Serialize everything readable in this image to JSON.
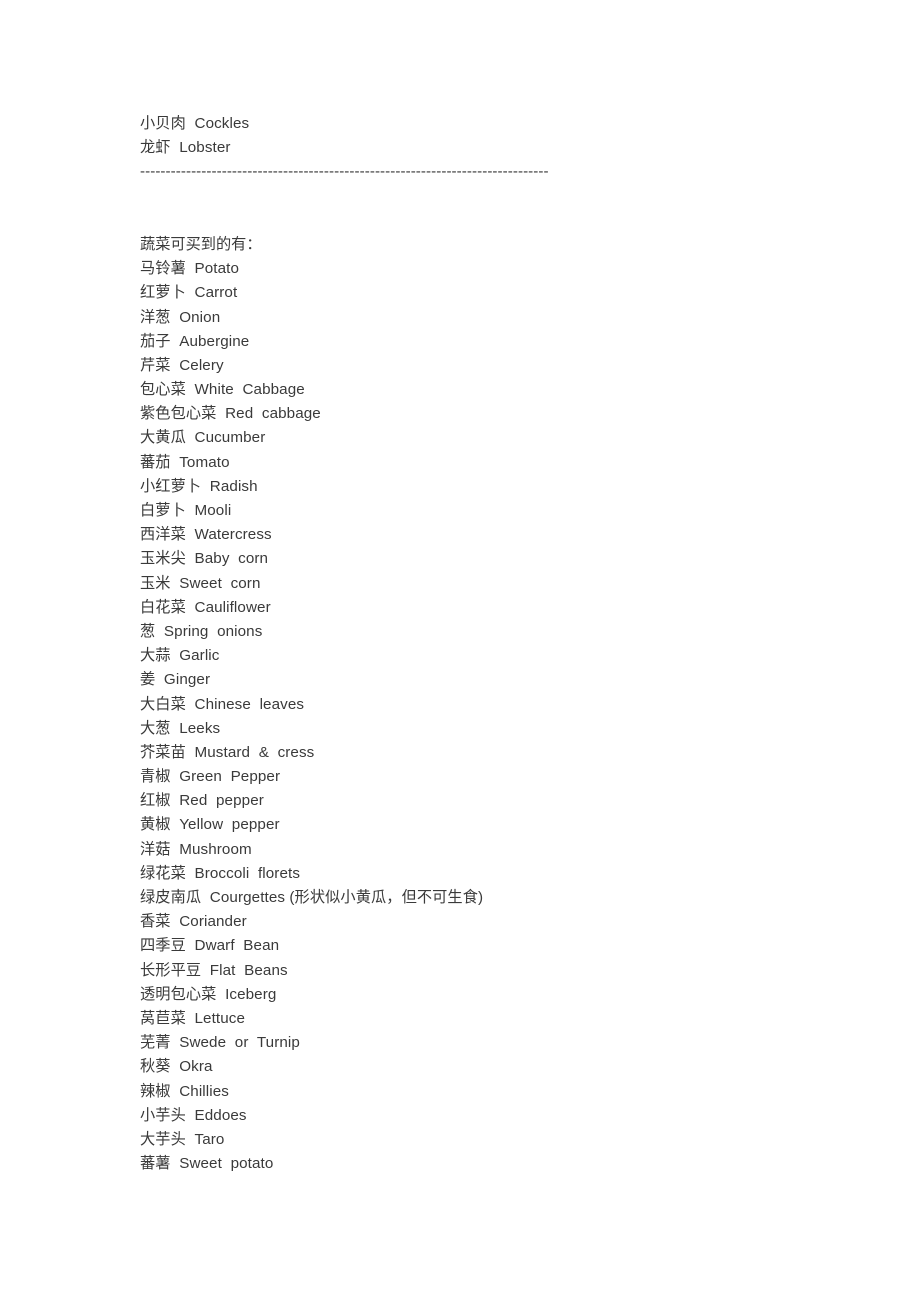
{
  "document": {
    "seafood_tail": [
      {
        "zh": "小贝肉",
        "en": "Cockles"
      },
      {
        "zh": "龙虾",
        "en": "Lobster"
      }
    ],
    "separator": "--------------------------------------------------------------------------------",
    "vegetables_heading": "蔬菜可买到的有：",
    "vegetables": [
      {
        "zh": "马铃薯",
        "en": "Potato"
      },
      {
        "zh": "红萝卜",
        "en": "Carrot"
      },
      {
        "zh": "洋葱",
        "en": "Onion"
      },
      {
        "zh": "茄子",
        "en": "Aubergine"
      },
      {
        "zh": "芹菜",
        "en": "Celery"
      },
      {
        "zh": "包心菜",
        "en": "White  Cabbage"
      },
      {
        "zh": "紫色包心菜",
        "en": "Red  cabbage"
      },
      {
        "zh": "大黄瓜",
        "en": "Cucumber"
      },
      {
        "zh": "蕃茄",
        "en": "Tomato"
      },
      {
        "zh": "小红萝卜",
        "en": "Radish"
      },
      {
        "zh": "白萝卜",
        "en": "Mooli"
      },
      {
        "zh": "西洋菜",
        "en": "Watercress"
      },
      {
        "zh": "玉米尖",
        "en": "Baby  corn"
      },
      {
        "zh": "玉米",
        "en": "Sweet  corn"
      },
      {
        "zh": "白花菜",
        "en": "Cauliflower"
      },
      {
        "zh": "葱",
        "en": "Spring  onions"
      },
      {
        "zh": "大蒜",
        "en": "Garlic"
      },
      {
        "zh": "姜",
        "en": "Ginger"
      },
      {
        "zh": "大白菜",
        "en": "Chinese  leaves"
      },
      {
        "zh": "大葱",
        "en": "Leeks"
      },
      {
        "zh": "芥菜苗",
        "en": "Mustard  &  cress"
      },
      {
        "zh": "青椒",
        "en": "Green  Pepper"
      },
      {
        "zh": "红椒",
        "en": "Red  pepper"
      },
      {
        "zh": "黄椒",
        "en": "Yellow  pepper"
      },
      {
        "zh": "洋菇",
        "en": "Mushroom"
      },
      {
        "zh": "绿花菜",
        "en": "Broccoli  florets"
      },
      {
        "zh": "绿皮南瓜",
        "en": "Courgettes (形状似小黄瓜，但不可生食)"
      },
      {
        "zh": "香菜",
        "en": "Coriander"
      },
      {
        "zh": "四季豆",
        "en": "Dwarf  Bean"
      },
      {
        "zh": "长形平豆",
        "en": "Flat  Beans"
      },
      {
        "zh": "透明包心菜",
        "en": "Iceberg"
      },
      {
        "zh": "莴苣菜",
        "en": "Lettuce"
      },
      {
        "zh": "芜菁",
        "en": "Swede  or  Turnip"
      },
      {
        "zh": "秋葵",
        "en": "Okra"
      },
      {
        "zh": "辣椒",
        "en": "Chillies"
      },
      {
        "zh": "小芋头",
        "en": "Eddoes"
      },
      {
        "zh": "大芋头",
        "en": "Taro"
      },
      {
        "zh": "蕃薯",
        "en": "Sweet  potato"
      }
    ]
  }
}
